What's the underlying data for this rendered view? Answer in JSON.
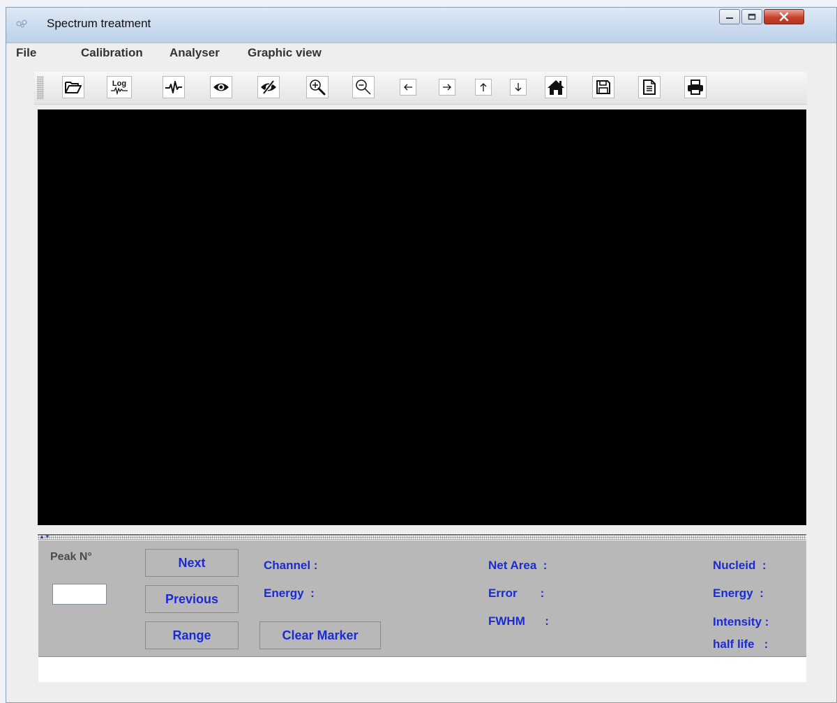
{
  "window": {
    "title": "Spectrum treatment"
  },
  "menu": [
    "File",
    "Calibration",
    "Analyser",
    "Graphic view"
  ],
  "toolbar": {
    "log_label": "Log",
    "buttons": [
      "open-folder-icon",
      "log-scale-icon",
      "pulse-icon",
      "eye-icon",
      "eye-off-icon",
      "zoom-in-icon",
      "zoom-out-icon",
      "arrow-left-icon",
      "arrow-right-icon",
      "arrow-up-icon",
      "arrow-down-icon",
      "home-icon",
      "save-icon",
      "document-icon",
      "print-icon"
    ]
  },
  "panel": {
    "peak_label": "Peak N°",
    "peak_value": "",
    "next_label": "Next",
    "previous_label": "Previous",
    "range_label": "Range",
    "clear_marker_label": "Clear Marker",
    "channel_label": "Channel :",
    "energy_label": "Energy  :",
    "net_area_label": "Net Area  :",
    "error_label": "Error       :",
    "fwhm_label": "FWHM      :",
    "nucleid_label": "Nucleid  :",
    "nucleid_energy_label": "Energy  :",
    "intensity_label": "Intensity :",
    "half_life_label": "half life   :"
  },
  "colors": {
    "label_blue": "#1a2bd6",
    "panel_gray": "#b8b8b8",
    "canvas": "#000000"
  }
}
